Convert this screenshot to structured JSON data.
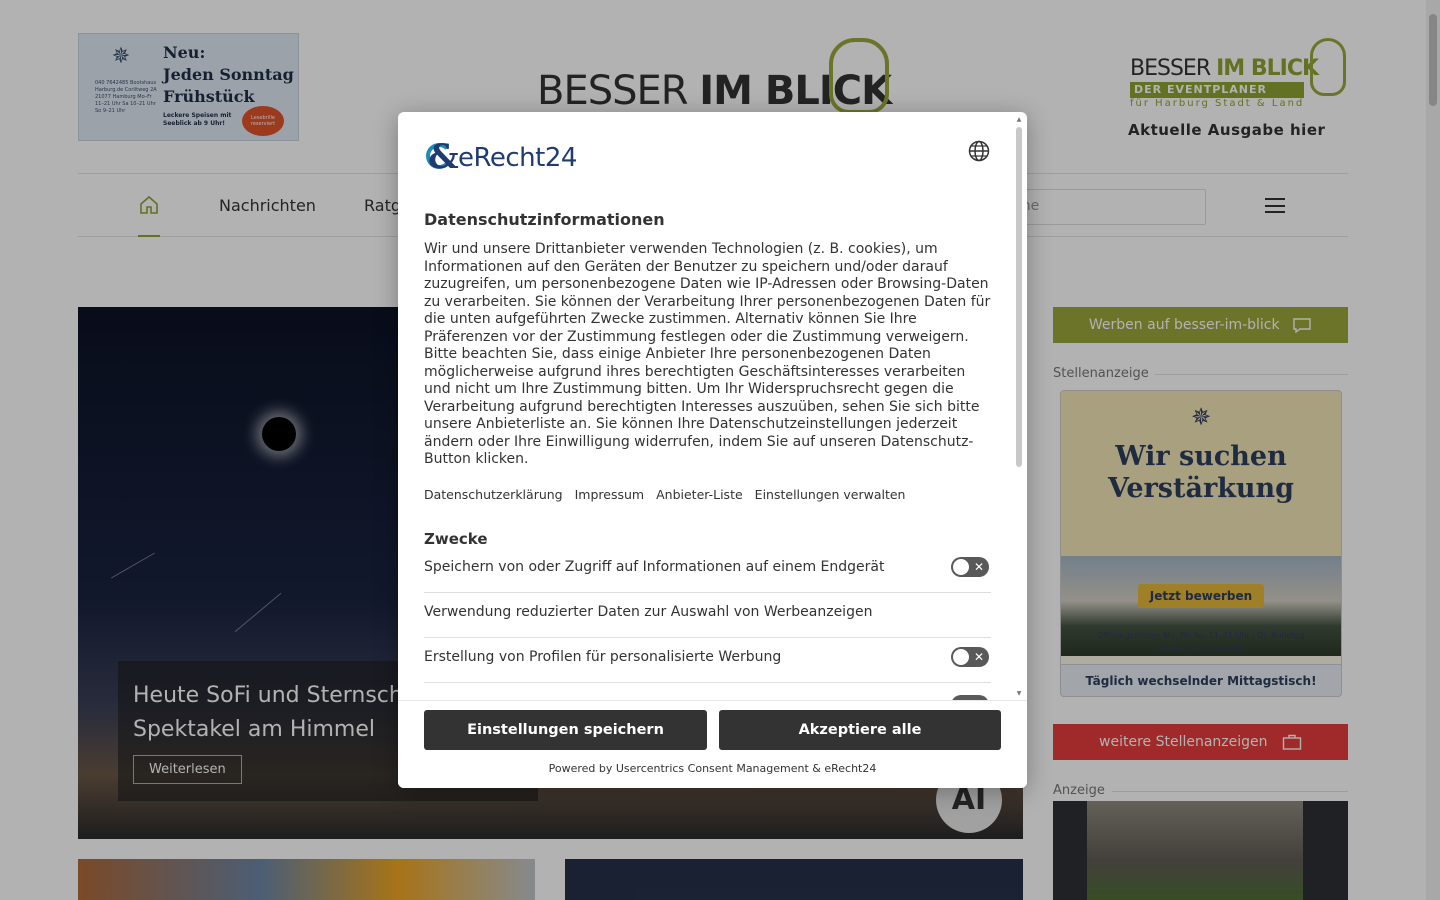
{
  "header": {
    "ad_left": {
      "headline_lines": [
        "Neu:",
        "Jeden Sonntag",
        "Frühstück"
      ],
      "brand": "BOOTSHAUS",
      "small_text": "040 7642485 Bootshaus Harburg.de Corlitweg 2A 21077 Hamburg Mo–Fr 11–21 Uhr Sa 10–21 Uhr So 9–21 Uhr",
      "sub_text": "Leckere Speisen mit Seeblick ab 9 Uhr!",
      "badge": "Lesebrille reserviert"
    },
    "logo_center": {
      "text_light": "BESSER ",
      "text_bold": "IM BLICK"
    },
    "logo_right": {
      "line1_light": "BESSER ",
      "line1_bold": "IM BLICK",
      "line2": "DER EVENTPLANER",
      "line3": "für Harburg Stadt & Land",
      "cta": "Aktuelle Ausgabe hier"
    }
  },
  "nav": {
    "items": [
      "Nachrichten",
      "Ratg"
    ],
    "search_placeholder": "che"
  },
  "hero": {
    "title": "Heute SoFi und Sternschr Spektakel am Himmel",
    "button": "Weiterlesen",
    "ai_badge": "AI"
  },
  "sidebar": {
    "green_button": "Werben auf besser-im-blick",
    "label_jobs": "Stellenanzeige",
    "job_ad": {
      "brand": "BOOTSHAUS",
      "headline_lines": [
        "Wir suchen",
        "Verstärkung"
      ],
      "button": "Jetzt bewerben",
      "hours": "Öffnungszeiten: Mo, Mi–So: 11–21 Uhr | Di: Ruhetag",
      "phone": "Telefon: 040 7642485",
      "footer": "Täglich wechselnder Mittagstisch!"
    },
    "red_button": "weitere Stellenanzeigen",
    "label_ad": "Anzeige"
  },
  "consent": {
    "brand_name": "eRecht24",
    "title": "Datenschutzinformationen",
    "body": "Wir und unsere Drittanbieter verwenden Technologien (z. B. cookies), um Informationen auf den Geräten der Benutzer zu speichern und/oder darauf zuzugreifen, um personenbezogene Daten wie IP-Adressen oder Browsing-Daten zu verarbeiten. Sie können der Verarbeitung Ihrer personenbezogenen Daten für die unten aufgeführten Zwecke zustimmen. Alternativ können Sie Ihre Präferenzen vor der Zustimmung festlegen oder die Zustimmung verweigern. Bitte beachten Sie, dass einige Anbieter Ihre personenbezogenen Daten möglicherweise aufgrund ihres berechtigten Geschäftsinteresses verarbeiten und nicht um Ihre Zustimmung bitten. Um Ihr Widerspruchsrecht gegen die Verarbeitung aufgrund berechtigten Interesses auszuüben, sehen Sie sich bitte unsere Anbieterliste an. Sie können Ihre Datenschutzeinstellungen jederzeit ändern oder Ihre Einwilligung widerrufen, indem Sie auf unseren Datenschutz-Button klicken.",
    "links": [
      "Datenschutzerklärung",
      "Impressum",
      "Anbieter-Liste",
      "Einstellungen verwalten"
    ],
    "purposes_title": "Zwecke",
    "purposes": [
      {
        "label": "Speichern von oder Zugriff auf Informationen auf einem Endgerät",
        "toggle": true,
        "enabled": false
      },
      {
        "label": "Verwendung reduzierter Daten zur Auswahl von Werbeanzeigen",
        "toggle": false,
        "enabled": false
      },
      {
        "label": "Erstellung von Profilen für personalisierte Werbung",
        "toggle": true,
        "enabled": false
      }
    ],
    "save_button": "Einstellungen speichern",
    "accept_button": "Akzeptiere alle",
    "powered_by": "Powered by Usercentrics Consent Management & eRecht24"
  },
  "colors": {
    "brand_green": "#9aa63a",
    "alert_red": "#e53b3b",
    "dark_button": "#333333",
    "erecht_blue": "#1f3c72"
  }
}
